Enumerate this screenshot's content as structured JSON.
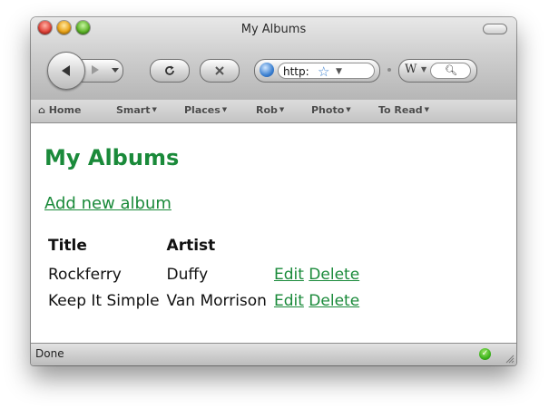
{
  "window": {
    "title": "My Albums"
  },
  "toolbar": {
    "url": "http:",
    "icons": [
      "back-arrow-icon",
      "forward-arrow-icon",
      "reload-icon",
      "stop-icon",
      "globe-icon",
      "bookmark-star-icon",
      "wikipedia-icon",
      "search-icon"
    ]
  },
  "bookmarks": [
    "Home",
    "Smart",
    "Places",
    "Rob",
    "Photo",
    "To Read"
  ],
  "page": {
    "heading": "My Albums",
    "add_link": "Add new album",
    "table": {
      "headers": [
        "Title",
        "Artist"
      ],
      "rows": [
        {
          "title": "Rockferry",
          "artist": "Duffy",
          "edit": "Edit",
          "delete": "Delete"
        },
        {
          "title": "Keep It Simple",
          "artist": "Van Morrison",
          "edit": "Edit",
          "delete": "Delete"
        }
      ]
    }
  },
  "status": {
    "text": "Done"
  },
  "colors": {
    "accent": "#1a8a3a",
    "secure": "#3bb21b"
  }
}
